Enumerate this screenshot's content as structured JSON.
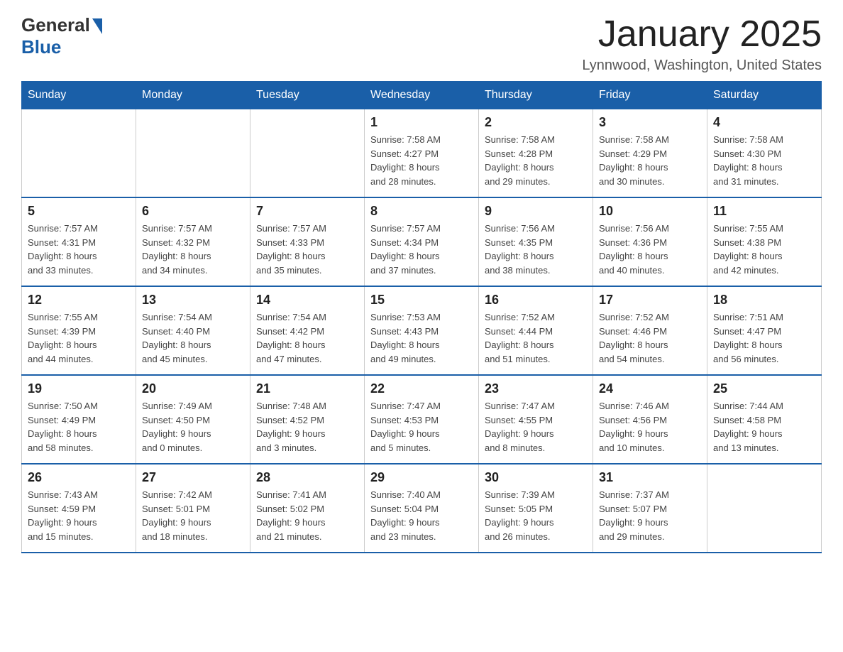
{
  "logo": {
    "text_general": "General",
    "text_blue": "Blue"
  },
  "header": {
    "title": "January 2025",
    "location": "Lynnwood, Washington, United States"
  },
  "days_of_week": [
    "Sunday",
    "Monday",
    "Tuesday",
    "Wednesday",
    "Thursday",
    "Friday",
    "Saturday"
  ],
  "weeks": [
    [
      {
        "day": "",
        "info": ""
      },
      {
        "day": "",
        "info": ""
      },
      {
        "day": "",
        "info": ""
      },
      {
        "day": "1",
        "info": "Sunrise: 7:58 AM\nSunset: 4:27 PM\nDaylight: 8 hours\nand 28 minutes."
      },
      {
        "day": "2",
        "info": "Sunrise: 7:58 AM\nSunset: 4:28 PM\nDaylight: 8 hours\nand 29 minutes."
      },
      {
        "day": "3",
        "info": "Sunrise: 7:58 AM\nSunset: 4:29 PM\nDaylight: 8 hours\nand 30 minutes."
      },
      {
        "day": "4",
        "info": "Sunrise: 7:58 AM\nSunset: 4:30 PM\nDaylight: 8 hours\nand 31 minutes."
      }
    ],
    [
      {
        "day": "5",
        "info": "Sunrise: 7:57 AM\nSunset: 4:31 PM\nDaylight: 8 hours\nand 33 minutes."
      },
      {
        "day": "6",
        "info": "Sunrise: 7:57 AM\nSunset: 4:32 PM\nDaylight: 8 hours\nand 34 minutes."
      },
      {
        "day": "7",
        "info": "Sunrise: 7:57 AM\nSunset: 4:33 PM\nDaylight: 8 hours\nand 35 minutes."
      },
      {
        "day": "8",
        "info": "Sunrise: 7:57 AM\nSunset: 4:34 PM\nDaylight: 8 hours\nand 37 minutes."
      },
      {
        "day": "9",
        "info": "Sunrise: 7:56 AM\nSunset: 4:35 PM\nDaylight: 8 hours\nand 38 minutes."
      },
      {
        "day": "10",
        "info": "Sunrise: 7:56 AM\nSunset: 4:36 PM\nDaylight: 8 hours\nand 40 minutes."
      },
      {
        "day": "11",
        "info": "Sunrise: 7:55 AM\nSunset: 4:38 PM\nDaylight: 8 hours\nand 42 minutes."
      }
    ],
    [
      {
        "day": "12",
        "info": "Sunrise: 7:55 AM\nSunset: 4:39 PM\nDaylight: 8 hours\nand 44 minutes."
      },
      {
        "day": "13",
        "info": "Sunrise: 7:54 AM\nSunset: 4:40 PM\nDaylight: 8 hours\nand 45 minutes."
      },
      {
        "day": "14",
        "info": "Sunrise: 7:54 AM\nSunset: 4:42 PM\nDaylight: 8 hours\nand 47 minutes."
      },
      {
        "day": "15",
        "info": "Sunrise: 7:53 AM\nSunset: 4:43 PM\nDaylight: 8 hours\nand 49 minutes."
      },
      {
        "day": "16",
        "info": "Sunrise: 7:52 AM\nSunset: 4:44 PM\nDaylight: 8 hours\nand 51 minutes."
      },
      {
        "day": "17",
        "info": "Sunrise: 7:52 AM\nSunset: 4:46 PM\nDaylight: 8 hours\nand 54 minutes."
      },
      {
        "day": "18",
        "info": "Sunrise: 7:51 AM\nSunset: 4:47 PM\nDaylight: 8 hours\nand 56 minutes."
      }
    ],
    [
      {
        "day": "19",
        "info": "Sunrise: 7:50 AM\nSunset: 4:49 PM\nDaylight: 8 hours\nand 58 minutes."
      },
      {
        "day": "20",
        "info": "Sunrise: 7:49 AM\nSunset: 4:50 PM\nDaylight: 9 hours\nand 0 minutes."
      },
      {
        "day": "21",
        "info": "Sunrise: 7:48 AM\nSunset: 4:52 PM\nDaylight: 9 hours\nand 3 minutes."
      },
      {
        "day": "22",
        "info": "Sunrise: 7:47 AM\nSunset: 4:53 PM\nDaylight: 9 hours\nand 5 minutes."
      },
      {
        "day": "23",
        "info": "Sunrise: 7:47 AM\nSunset: 4:55 PM\nDaylight: 9 hours\nand 8 minutes."
      },
      {
        "day": "24",
        "info": "Sunrise: 7:46 AM\nSunset: 4:56 PM\nDaylight: 9 hours\nand 10 minutes."
      },
      {
        "day": "25",
        "info": "Sunrise: 7:44 AM\nSunset: 4:58 PM\nDaylight: 9 hours\nand 13 minutes."
      }
    ],
    [
      {
        "day": "26",
        "info": "Sunrise: 7:43 AM\nSunset: 4:59 PM\nDaylight: 9 hours\nand 15 minutes."
      },
      {
        "day": "27",
        "info": "Sunrise: 7:42 AM\nSunset: 5:01 PM\nDaylight: 9 hours\nand 18 minutes."
      },
      {
        "day": "28",
        "info": "Sunrise: 7:41 AM\nSunset: 5:02 PM\nDaylight: 9 hours\nand 21 minutes."
      },
      {
        "day": "29",
        "info": "Sunrise: 7:40 AM\nSunset: 5:04 PM\nDaylight: 9 hours\nand 23 minutes."
      },
      {
        "day": "30",
        "info": "Sunrise: 7:39 AM\nSunset: 5:05 PM\nDaylight: 9 hours\nand 26 minutes."
      },
      {
        "day": "31",
        "info": "Sunrise: 7:37 AM\nSunset: 5:07 PM\nDaylight: 9 hours\nand 29 minutes."
      },
      {
        "day": "",
        "info": ""
      }
    ]
  ]
}
